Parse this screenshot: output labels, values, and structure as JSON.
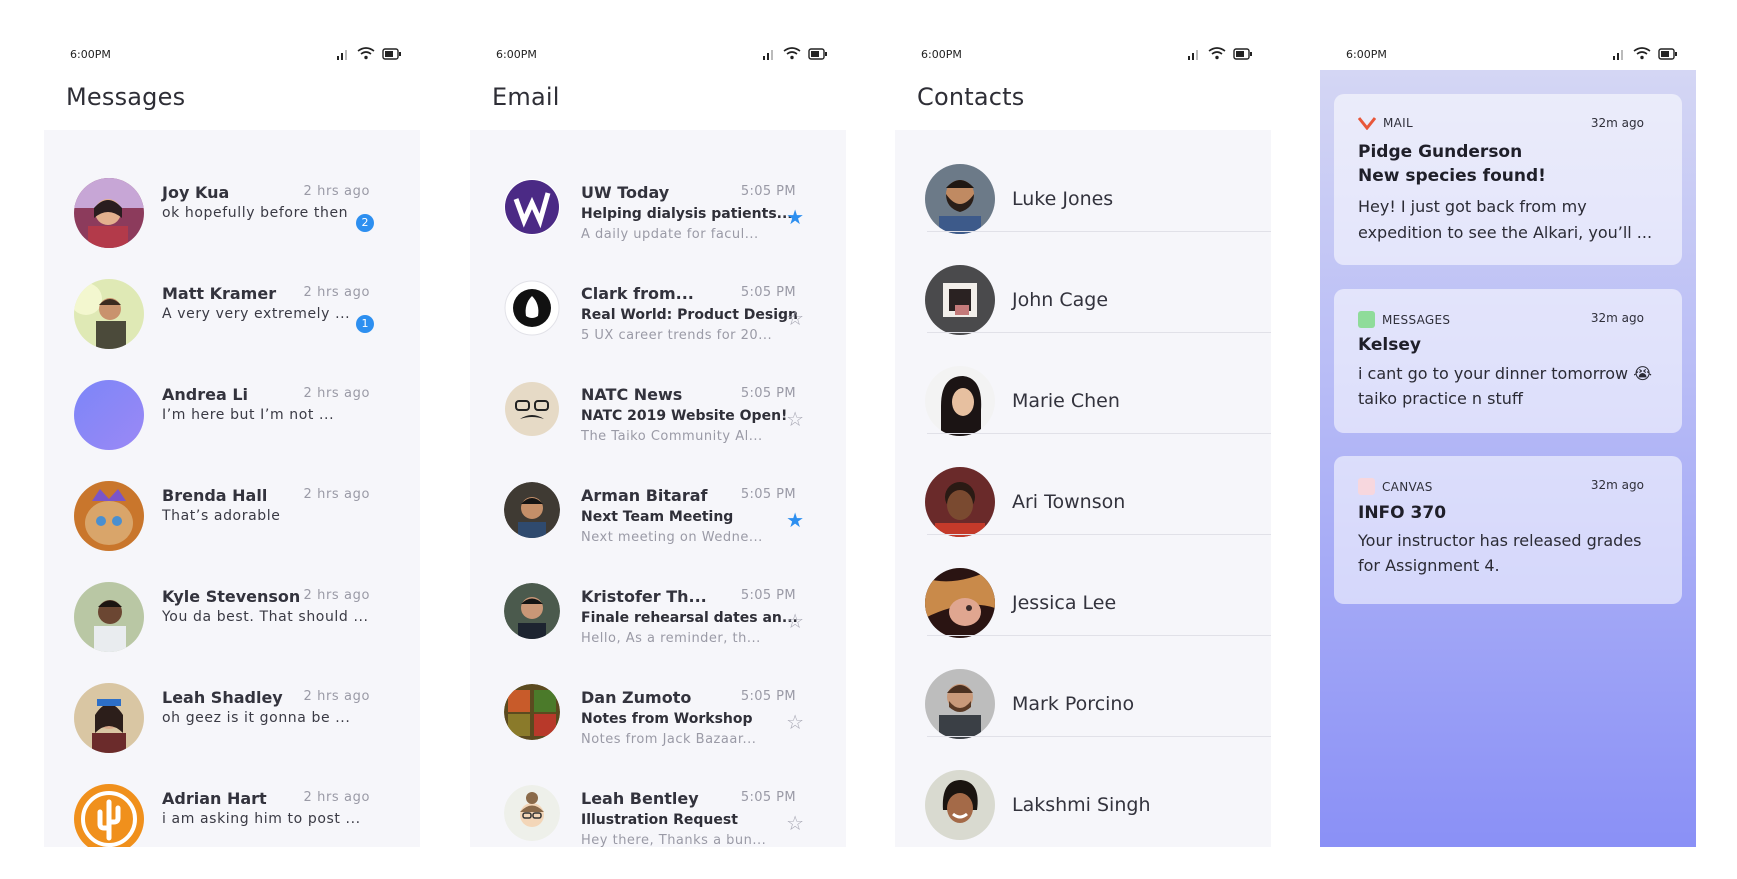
{
  "status": {
    "time": "6:00PM"
  },
  "messages": {
    "title": "Messages",
    "rows": [
      {
        "name": "Joy Kua",
        "time": "2 hrs ago",
        "text": "ok hopefully before then",
        "badge": "2"
      },
      {
        "name": "Matt Kramer",
        "time": "2 hrs ago",
        "text": "A very very extremely ...",
        "badge": "1"
      },
      {
        "name": "Andrea Li",
        "time": "2 hrs ago",
        "text": "I’m here but I’m not ...",
        "badge": ""
      },
      {
        "name": "Brenda Hall",
        "time": "2 hrs ago",
        "text": "That’s adorable",
        "badge": ""
      },
      {
        "name": "Kyle Stevenson",
        "time": "2 hrs ago",
        "text": "You da best. That should ...",
        "badge": ""
      },
      {
        "name": "Leah Shadley",
        "time": "2 hrs ago",
        "text": "oh geez is it gonna be ...",
        "badge": ""
      },
      {
        "name": "Adrian Hart",
        "time": "2 hrs ago",
        "text": "i am asking him to post ...",
        "badge": ""
      }
    ]
  },
  "email": {
    "title": "Email",
    "rows": [
      {
        "from": "UW Today",
        "time": "5:05 PM",
        "subject": "Helping dialysis patients...",
        "preview": "A daily update for facul...",
        "starred": true
      },
      {
        "from": "Clark from...",
        "time": "5:05 PM",
        "subject": "Real World: Product Design",
        "preview": "5 UX career trends for 20...",
        "starred": false
      },
      {
        "from": "NATC News",
        "time": "5:05 PM",
        "subject": "NATC 2019 Website Open!",
        "preview": "The Taiko Community Al...",
        "starred": false
      },
      {
        "from": "Arman Bitaraf",
        "time": "5:05 PM",
        "subject": "Next Team Meeting",
        "preview": "Next meeting on Wedne...",
        "starred": true
      },
      {
        "from": "Kristofer Th...",
        "time": "5:05 PM",
        "subject": "Finale rehearsal dates an...",
        "preview": "Hello, As a reminder, th...",
        "starred": false
      },
      {
        "from": "Dan Zumoto",
        "time": "5:05 PM",
        "subject": "Notes from Workshop",
        "preview": "Notes from Jack Bazaar...",
        "starred": false
      },
      {
        "from": "Leah Bentley",
        "time": "5:05 PM",
        "subject": "Illustration Request",
        "preview": "Hey there, Thanks a bun...",
        "starred": false
      }
    ],
    "star_on": "★",
    "star_off": "☆"
  },
  "contacts": {
    "title": "Contacts",
    "rows": [
      {
        "name": "Luke Jones"
      },
      {
        "name": "John Cage"
      },
      {
        "name": "Marie Chen"
      },
      {
        "name": "Ari Townson"
      },
      {
        "name": "Jessica Lee"
      },
      {
        "name": "Mark Porcino"
      },
      {
        "name": "Lakshmi Singh"
      }
    ]
  },
  "notifications": [
    {
      "app": "MAIL",
      "age": "32m ago",
      "title": "Pidge Gunderson\nNew species found!",
      "body": "Hey! I just got back from my expedition to see the Alkari, you’ll ...",
      "icon": "mail-icon",
      "color": "#e8573a"
    },
    {
      "app": "MESSAGES",
      "age": "32m ago",
      "title": "Kelsey",
      "body": "i cant go to your dinner tomorrow 😭 taiko practice n stuff",
      "icon": "messages-icon",
      "color": "#8fdc9a"
    },
    {
      "app": "CANVAS",
      "age": "32m ago",
      "title": "INFO 370",
      "body": "Your instructor has released grades for Assignment 4.",
      "icon": "canvas-icon",
      "color": "#f7d7de"
    }
  ],
  "colors": {
    "accent": "#2d8ff0",
    "panel": "#f6f6fa"
  }
}
